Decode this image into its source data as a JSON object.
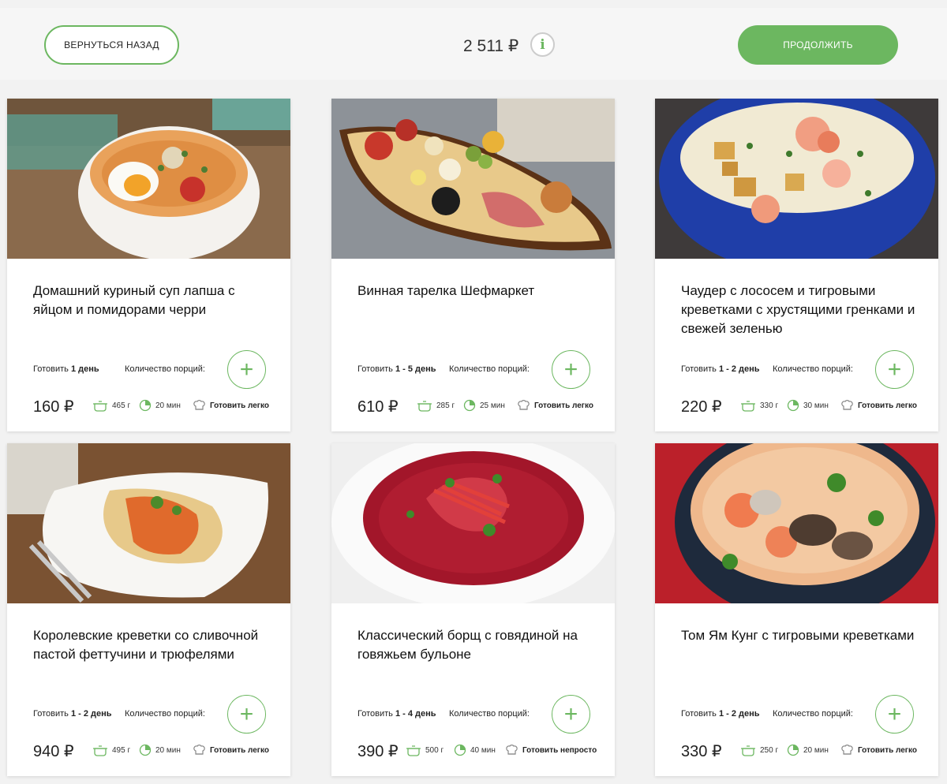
{
  "header": {
    "back_label": "ВЕРНУТЬСЯ НАЗАД",
    "total": "2 511 ₽",
    "info_icon": "i",
    "continue_label": "ПРОДОЛЖИТЬ"
  },
  "colors": {
    "accent": "#6cb760"
  },
  "labels": {
    "cook_prefix": "Готовить",
    "portions": "Количество порций:",
    "add": "+"
  },
  "cards": [
    {
      "title": "Домашний куриный суп лапша с яйцом и помидорами черри",
      "days": "1 день",
      "price": "160 ₽",
      "weight": "465 г",
      "time": "20 мин",
      "difficulty": "Готовить легко"
    },
    {
      "title": "Винная тарелка Шефмаркет",
      "days": "1 - 5 день",
      "price": "610 ₽",
      "weight": "285 г",
      "time": "25 мин",
      "difficulty": "Готовить легко"
    },
    {
      "title": "Чаудер с лососем и тигровыми креветками с хрустящими гренками и свежей зеленью",
      "days": "1 - 2 день",
      "price": "220 ₽",
      "weight": "330 г",
      "time": "30 мин",
      "difficulty": "Готовить легко"
    },
    {
      "title": "Королевские креветки со сливочной пастой феттучини и трюфелями",
      "days": "1 - 2 день",
      "price": "940 ₽",
      "weight": "495 г",
      "time": "20 мин",
      "difficulty": "Готовить легко"
    },
    {
      "title": "Классический борщ с говядиной на говяжьем бульоне",
      "days": "1 - 4 день",
      "price": "390 ₽",
      "weight": "500 г",
      "time": "40 мин",
      "difficulty": "Готовить непросто"
    },
    {
      "title": "Том Ям Кунг с тигровыми креветками",
      "days": "1 - 2 день",
      "price": "330 ₽",
      "weight": "250 г",
      "time": "20 мин",
      "difficulty": "Готовить легко"
    }
  ]
}
